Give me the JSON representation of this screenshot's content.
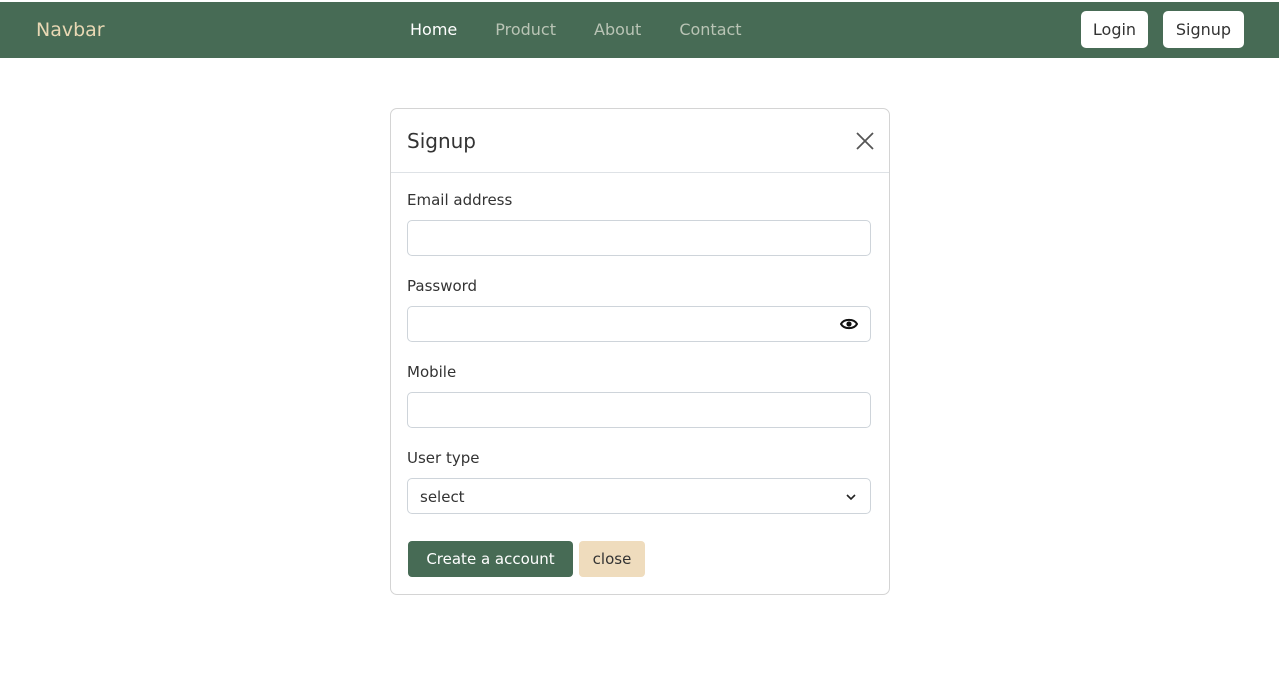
{
  "navbar": {
    "brand": "Navbar",
    "links": [
      {
        "label": "Home"
      },
      {
        "label": "Product"
      },
      {
        "label": "About"
      },
      {
        "label": "Contact"
      }
    ],
    "login_label": "Login",
    "signup_label": "Signup",
    "background": "#476b55"
  },
  "modal": {
    "title": "Signup",
    "email_label": "Email address",
    "email_value": "",
    "password_label": "Password",
    "password_value": "",
    "mobile_label": "Mobile",
    "mobile_value": "",
    "usertype_label": "User type",
    "usertype_selected": "select",
    "create_label": "Create a account",
    "close_label": "close",
    "icons": {
      "close": "close-icon",
      "eye": "eye-icon",
      "chevron": "chevron-down-icon"
    }
  },
  "colors": {
    "primary": "#476b55",
    "secondary": "#efdcbd",
    "brand_text": "#e9d8b4"
  }
}
